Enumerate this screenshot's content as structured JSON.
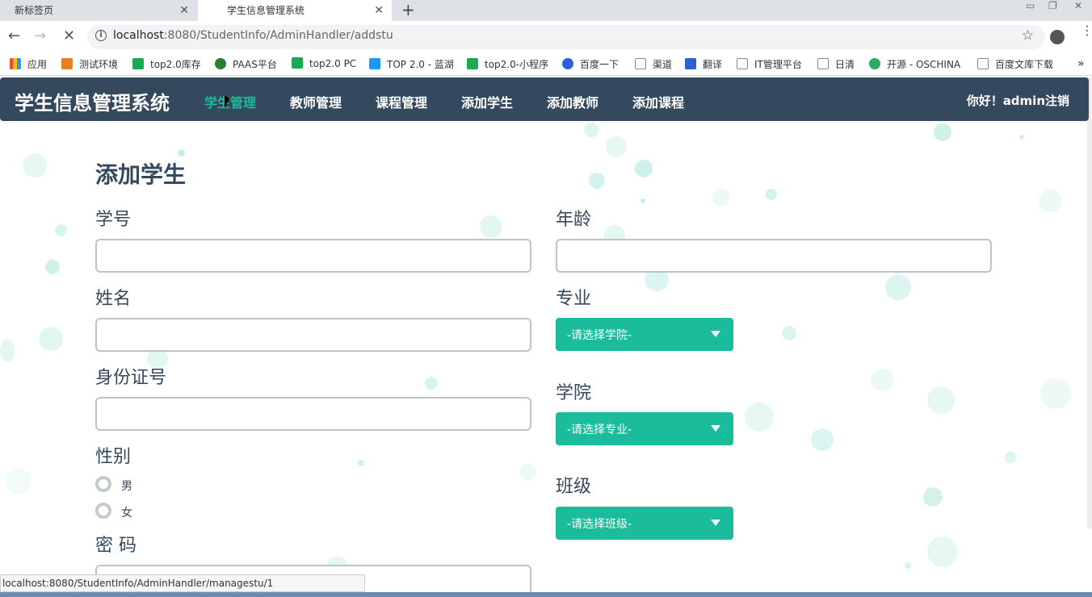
{
  "tabs": [
    {
      "title": "新标签页",
      "close": "✕"
    },
    {
      "title": "学生信息管理系统",
      "close": "✕"
    }
  ],
  "newtab": "+",
  "address": {
    "host": "localhost",
    "path": ":8080/StudentInfo/AdminHandler/addstu"
  },
  "bookmarks": [
    {
      "label": "应用",
      "icon": "apps-icon",
      "color": "#e74c3c"
    },
    {
      "label": "测试环境",
      "icon": "u-icon",
      "color": "#e67e22"
    },
    {
      "label": "top2.0库存",
      "icon": "play-icon",
      "color": "#1aaa55"
    },
    {
      "label": "PAAS平台",
      "icon": "globe-icon",
      "color": "#2e7d32"
    },
    {
      "label": "top2.0 PC",
      "icon": "play-icon",
      "color": "#1aaa55"
    },
    {
      "label": "TOP 2.0 - 蓝湖",
      "icon": "lanhu-icon",
      "color": "#2196f3"
    },
    {
      "label": "top2.0-小程序",
      "icon": "play-icon",
      "color": "#1aaa55"
    },
    {
      "label": "百度一下",
      "icon": "paw-icon",
      "color": "#2a62d6"
    },
    {
      "label": "渠道",
      "icon": "page-icon",
      "color": "#888888"
    },
    {
      "label": "翻译",
      "icon": "translate-icon",
      "color": "#2a62d6"
    },
    {
      "label": "IT管理平台",
      "icon": "page-icon",
      "color": "#888888"
    },
    {
      "label": "日清",
      "icon": "page-icon",
      "color": "#888888"
    },
    {
      "label": "开源 - OSCHINA",
      "icon": "oschina-icon",
      "color": "#27ae60"
    },
    {
      "label": "百度文库下载",
      "icon": "page-icon",
      "color": "#888888"
    }
  ],
  "bookmarks_more": "»",
  "nav": {
    "brand": "学生信息管理系统",
    "links": [
      "学生管理",
      "教师管理",
      "课程管理",
      "添加学生",
      "添加教师",
      "添加课程"
    ],
    "greeting": "你好！admin注销"
  },
  "form": {
    "heading": "添加学生",
    "student_id_label": "学号",
    "name_label": "姓名",
    "idcard_label": "身份证号",
    "gender_label": "性别",
    "gender_options": [
      "男",
      "女"
    ],
    "password_label": "密 码",
    "age_label": "年龄",
    "major_label": "专业",
    "major_select": "-请选择学院-",
    "college_label": "学院",
    "college_select": "-请选择专业-",
    "class_label": "班级",
    "class_select": "-请选择班级-"
  },
  "status_url": "localhost:8080/StudentInfo/AdminHandler/managestu/1",
  "colors": {
    "navbar": "#34495e",
    "accent": "#1abc9c",
    "text": "#34495e"
  }
}
